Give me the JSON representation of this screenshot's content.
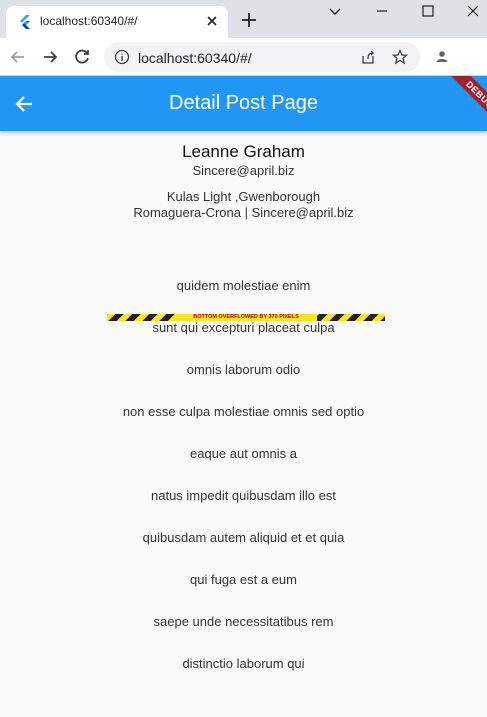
{
  "browser": {
    "tab_title": "localhost:60340/#/",
    "url": "localhost:60340/#/"
  },
  "app": {
    "title": "Detail Post Page",
    "debug_banner": "DEBUG",
    "accent_color": "#2196f3"
  },
  "user": {
    "name": "Leanne Graham",
    "email": "Sincere@april.biz",
    "address": "Kulas Light ,Gwenborough",
    "company_line": "Romaguera-Crona | Sincere@april.biz"
  },
  "overflow_warning": "BOTTOM OVERFLOWED BY 370 PIXELS",
  "posts": [
    "quidem molestiae enim",
    "sunt qui excepturi placeat culpa",
    "omnis laborum odio",
    "non esse culpa molestiae omnis sed optio",
    "eaque aut omnis a",
    "natus impedit quibusdam illo est",
    "quibusdam autem aliquid et et quia",
    "qui fuga est a eum",
    "saepe unde necessitatibus rem",
    "distinctio laborum qui"
  ]
}
